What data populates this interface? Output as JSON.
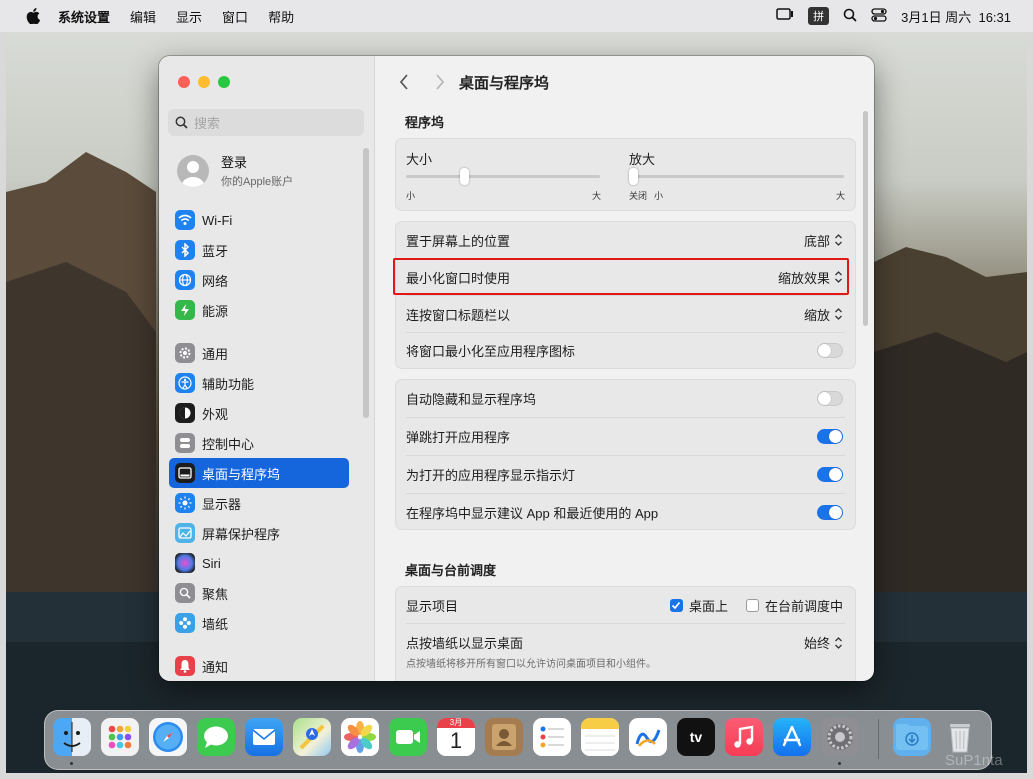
{
  "menubar": {
    "app_name": "系统设置",
    "items": [
      "编辑",
      "显示",
      "窗口",
      "帮助"
    ],
    "ime": "拼",
    "datetime": "3月1日 周六  16:31"
  },
  "sidebar": {
    "search_placeholder": "搜索",
    "account_title": "登录",
    "account_subtitle": "你的Apple账户",
    "items": [
      {
        "label": "Wi-Fi",
        "icon": "wifi-icon",
        "color": "#1e82f0"
      },
      {
        "label": "蓝牙",
        "icon": "bluetooth-icon",
        "color": "#1e82f0"
      },
      {
        "label": "网络",
        "icon": "globe-icon",
        "color": "#1e82f0"
      },
      {
        "label": "能源",
        "icon": "battery-icon",
        "color": "#34b84a"
      },
      {
        "label": "通用",
        "icon": "gear-icon",
        "color": "#8e8e93"
      },
      {
        "label": "辅助功能",
        "icon": "accessibility-icon",
        "color": "#1e82f0"
      },
      {
        "label": "外观",
        "icon": "appearance-icon",
        "color": "#1c1c1c"
      },
      {
        "label": "控制中心",
        "icon": "control-center-icon",
        "color": "#8e8e93"
      },
      {
        "label": "桌面与程序坞",
        "icon": "dock-icon",
        "color": "#1c1c1c"
      },
      {
        "label": "显示器",
        "icon": "display-icon",
        "color": "#1e82f0"
      },
      {
        "label": "屏幕保护程序",
        "icon": "screensaver-icon",
        "color": "#4fb3e8"
      },
      {
        "label": "Siri",
        "icon": "siri-icon",
        "color": "#6b3fa0"
      },
      {
        "label": "聚焦",
        "icon": "spotlight-icon",
        "color": "#8e8e93"
      },
      {
        "label": "墙纸",
        "icon": "wallpaper-icon",
        "color": "#3aa0e8"
      },
      {
        "label": "通知",
        "icon": "notifications-icon",
        "color": "#e8414a"
      }
    ],
    "active_index": 8
  },
  "main": {
    "title": "桌面与程序坞",
    "section1_title": "程序坞",
    "size_label": "大小",
    "size_min": "小",
    "size_max": "大",
    "size_value_percent": 30,
    "magnify_label": "放大",
    "magnify_off": "关闭",
    "magnify_min": "小",
    "magnify_max": "大",
    "magnify_value_percent": 0,
    "position_label": "置于屏幕上的位置",
    "position_value": "底部",
    "minimize_label": "最小化窗口时使用",
    "minimize_value": "缩放效果",
    "doubleclick_label": "连按窗口标题栏以",
    "doubleclick_value": "缩放",
    "minimize_to_icon_label": "将窗口最小化至应用程序图标",
    "minimize_to_icon_on": false,
    "autohide_label": "自动隐藏和显示程序坞",
    "autohide_on": false,
    "animate_label": "弹跳打开应用程序",
    "animate_on": true,
    "indicators_label": "为打开的应用程序显示指示灯",
    "indicators_on": true,
    "recents_label": "在程序坞中显示建议 App 和最近使用的 App",
    "recents_on": true,
    "section2_title": "桌面与台前调度",
    "show_items_label": "显示项目",
    "on_desktop_label": "桌面上",
    "on_desktop_checked": true,
    "in_stage_manager_label": "在台前调度中",
    "in_stage_manager_checked": false,
    "click_wallpaper_label": "点按墙纸以显示桌面",
    "click_wallpaper_value": "始终",
    "click_wallpaper_desc": "点按墙纸将移开所有窗口以允许访问桌面项目和小组件。"
  },
  "dock": {
    "calendar_month": "3月",
    "calendar_day": "1",
    "tv_label": "tv",
    "apps": [
      "finder-icon",
      "launchpad-icon",
      "safari-icon",
      "messages-icon",
      "mail-icon",
      "maps-icon",
      "photos-icon",
      "facetime-icon",
      "calendar-icon",
      "contacts-icon",
      "reminders-icon",
      "notes-icon",
      "freeform-icon",
      "apple-tv-icon",
      "music-icon",
      "app-store-icon",
      "system-settings-icon",
      "downloads-folder-icon",
      "trash-icon"
    ]
  },
  "watermark": "SuP1nta"
}
